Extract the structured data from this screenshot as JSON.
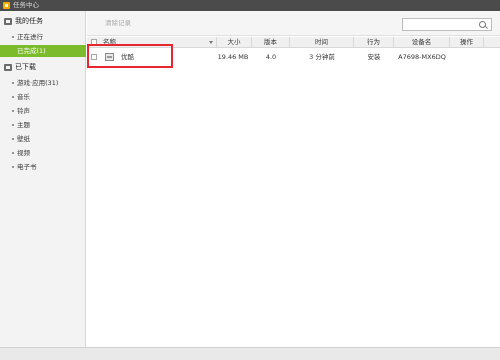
{
  "window": {
    "title": "任务中心"
  },
  "sidebar": {
    "my_tasks": {
      "label": "我的任务",
      "items": [
        {
          "label": "正在进行"
        },
        {
          "label": "已完成(1)"
        }
      ]
    },
    "downloaded": {
      "label": "已下载",
      "items": [
        {
          "label": "游戏·应用(31)"
        },
        {
          "label": "音乐"
        },
        {
          "label": "铃声"
        },
        {
          "label": "主题"
        },
        {
          "label": "壁纸"
        },
        {
          "label": "视频"
        },
        {
          "label": "电子书"
        }
      ]
    }
  },
  "toolbar": {
    "clear_label": "清除记录",
    "search_placeholder": ""
  },
  "table": {
    "headers": {
      "name": "名称",
      "size": "大小",
      "version": "版本",
      "time": "时间",
      "action": "行为",
      "device": "设备名",
      "operation": "操作"
    },
    "rows": [
      {
        "name": "优酷",
        "size": "19.46 MB",
        "version": "4.0",
        "time": "3 分钟前",
        "action": "安装",
        "device": "A7698-MX6DQ",
        "operation": ""
      }
    ]
  },
  "colors": {
    "accent": "#7cbb2c",
    "highlight": "#e8262f",
    "titlebar": "#4b4b4b"
  },
  "icons": {
    "app": "app-logo-icon",
    "tasks": "task-list-icon",
    "downloaded": "download-folder-icon",
    "search": "search-icon",
    "app_row": "app-thumbnail-icon"
  }
}
